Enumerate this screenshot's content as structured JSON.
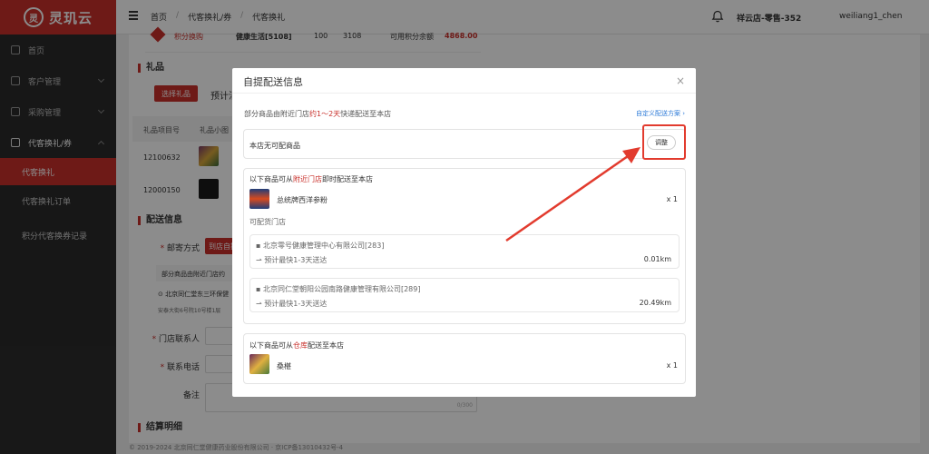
{
  "app": {
    "logo_mark": "灵",
    "name": "灵玑云"
  },
  "header": {
    "breadcrumbs": [
      "首页",
      "代客换礼/券",
      "代客换礼"
    ],
    "store": "祥云店-零售-352",
    "user": "weiliang1_chen"
  },
  "sidebar": {
    "items": [
      {
        "label": "首页"
      },
      {
        "label": "客户管理"
      },
      {
        "label": "采购管理"
      },
      {
        "label": "代客换礼/券"
      }
    ],
    "sub_items": [
      {
        "label": "代客换礼"
      },
      {
        "label": "代客换礼订单"
      },
      {
        "label": "积分代客换券记录"
      }
    ]
  },
  "page": {
    "top_fragment": [
      "积分换购",
      "健康生活[5108]",
      "100",
      "3108",
      "可用积分余额",
      "4868.00"
    ],
    "gift_section": "礼品",
    "select_gift_button": "选择礼品",
    "estimate_prefix": "预计消",
    "table_headers": [
      "礼品项目号",
      "礼品小图"
    ],
    "rows": [
      {
        "code": "12100632"
      },
      {
        "code": "12000150"
      }
    ],
    "delivery_section": "配送信息",
    "mail_method_label": "邮寄方式",
    "mail_method_value": "到店自提",
    "notice_fragment": "部分商品由附近门店约",
    "address_fragment": "北京同仁堂东三环保健",
    "address_line2": "安泰大街6号院10号楼1层",
    "contact_label": "门店联系人",
    "phone_label": "联系电话",
    "remark_label": "备注",
    "remark_counter": "0/300",
    "settle_section": "结算明细",
    "footer": "© 2019-2024 北京同仁堂健康药业股份有限公司 · 京ICP备13010432号-4"
  },
  "modal": {
    "title": "自提配送信息",
    "close": "×",
    "intro_prefix": "部分商品由附近门店",
    "intro_highlight": "约1～2天",
    "intro_suffix": "快递配送至本店",
    "custom_link": "自定义配送方案 ›",
    "no_stock_text": "本店无可配商品",
    "adjust_button": "调整",
    "nearby": {
      "title_prefix": "以下商品可从",
      "title_highlight": "附近门店",
      "title_suffix": "即时配送至本店",
      "product_name": "总统牌西洋参粉",
      "product_qty": "x 1",
      "stores_label": "可配货门店",
      "stores": [
        {
          "name": "北京零号健康管理中心有限公司[283]",
          "eta": "预计最快1-3天送达",
          "distance": "0.01km"
        },
        {
          "name": "北京同仁堂朝阳公园南路健康管理有限公司[289]",
          "eta": "预计最快1-3天送达",
          "distance": "20.49km"
        }
      ]
    },
    "warehouse": {
      "title_prefix": "以下商品可从",
      "title_highlight": "仓库",
      "title_suffix": "配送至本店",
      "product_name": "桑椹",
      "product_qty": "x 1"
    }
  },
  "colors": {
    "brand": "#c8302b",
    "link": "#2e7bd8",
    "annotation": "#e23b2e"
  }
}
